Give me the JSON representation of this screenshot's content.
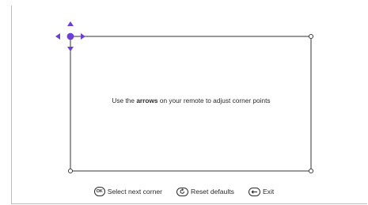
{
  "screen": {
    "instruction_prefix": "Use the ",
    "instruction_bold": "arrows",
    "instruction_suffix": " on your remote to adjust corner points",
    "accent_color": "#6b3fd8"
  },
  "footer": {
    "select_key": "OK",
    "select_label": "Select next corner",
    "reset_label": "Reset defaults",
    "exit_label": "Exit"
  },
  "icons": {
    "arrow_cluster": "dpad-arrows-icon",
    "reset": "reset-icon",
    "exit": "back-arrow-icon"
  }
}
